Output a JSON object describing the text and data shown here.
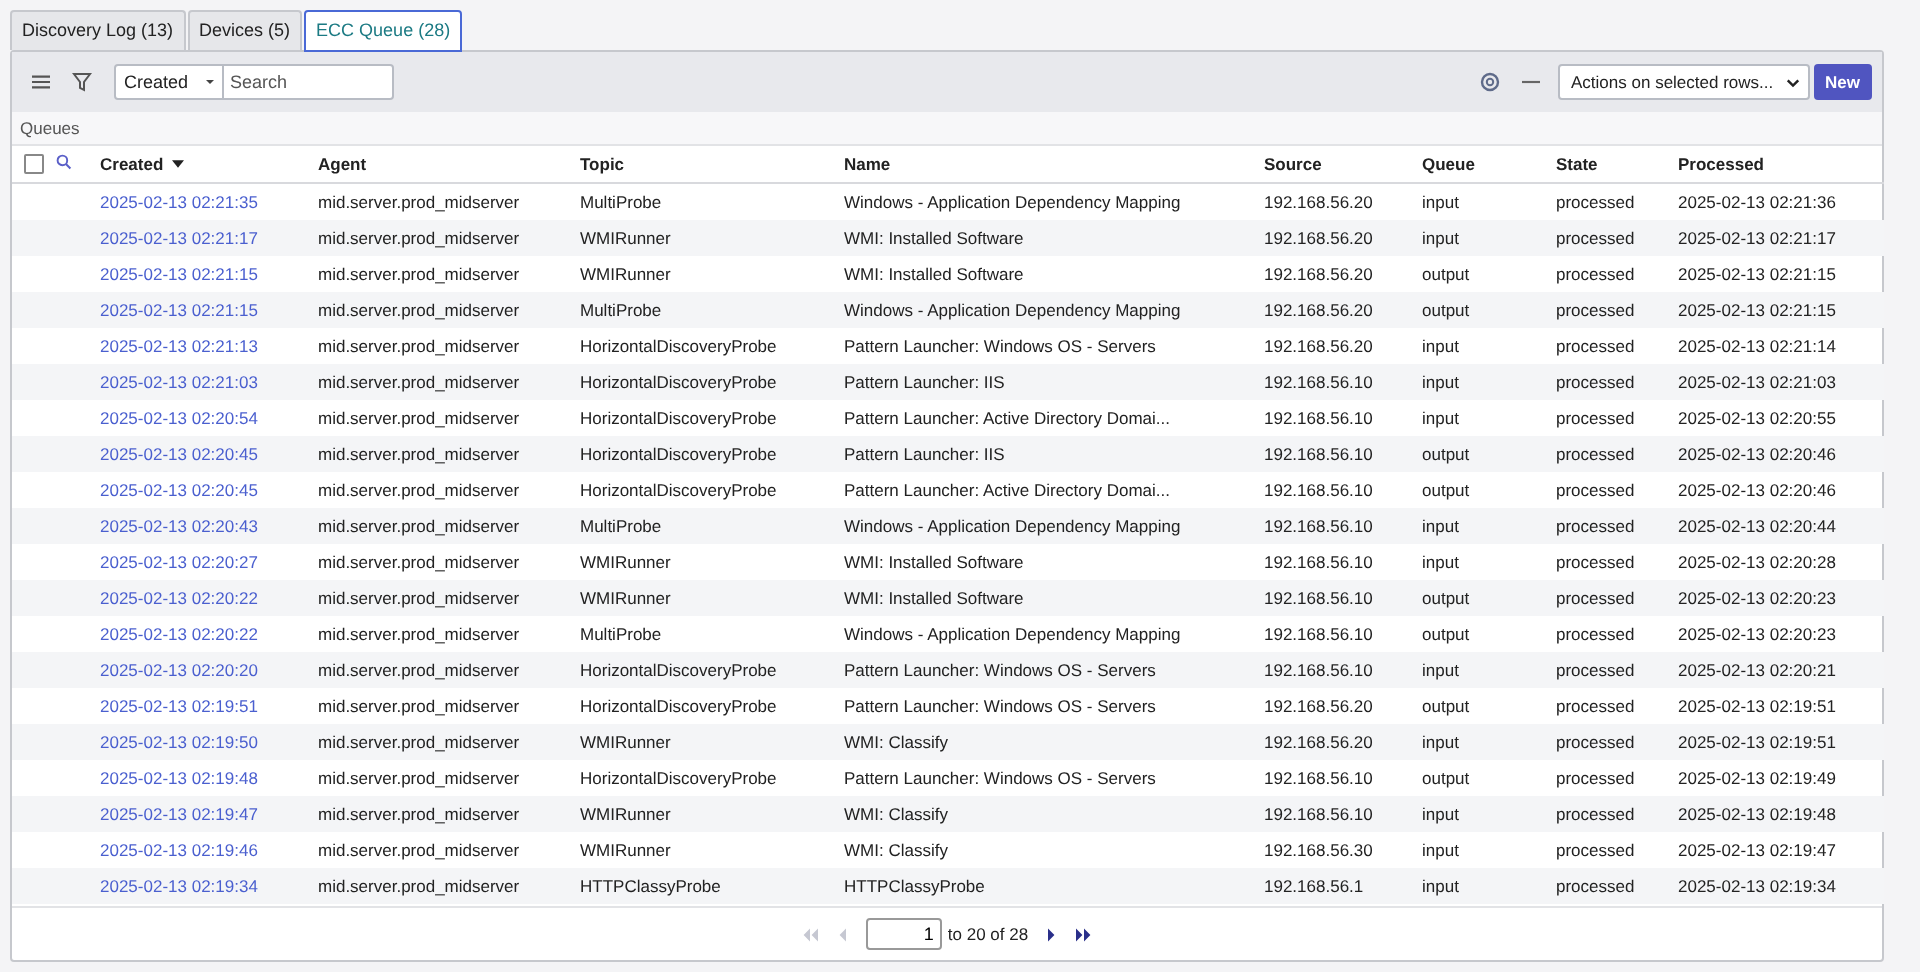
{
  "tabs": [
    {
      "label": "Discovery Log (13)",
      "selected": false
    },
    {
      "label": "Devices (5)",
      "selected": false
    },
    {
      "label": "ECC Queue (28)",
      "selected": true
    }
  ],
  "toolbar": {
    "filter_field": "Created",
    "search": {
      "placeholder": "Search"
    },
    "actions": "Actions on selected rows...",
    "new_button": "New"
  },
  "list_title": "Queues",
  "table": {
    "select_all": {
      "checked": false
    },
    "columns": [
      {
        "label": "Created",
        "sorted": true
      },
      {
        "label": "Agent",
        "sorted": false
      },
      {
        "label": "Topic",
        "sorted": false
      },
      {
        "label": "Name",
        "sorted": false
      },
      {
        "label": "Source",
        "sorted": false
      },
      {
        "label": "Queue",
        "sorted": false
      },
      {
        "label": "State",
        "sorted": false
      },
      {
        "label": "Processed",
        "sorted": false
      }
    ],
    "rows": [
      [
        "2025-02-13 02:21:35",
        "mid.server.prod_midserver",
        "MultiProbe",
        "Windows - Application Dependency Mapping",
        "192.168.56.20",
        "input",
        "processed",
        "2025-02-13 02:21:36"
      ],
      [
        "2025-02-13 02:21:17",
        "mid.server.prod_midserver",
        "WMIRunner",
        "WMI: Installed Software",
        "192.168.56.20",
        "input",
        "processed",
        "2025-02-13 02:21:17"
      ],
      [
        "2025-02-13 02:21:15",
        "mid.server.prod_midserver",
        "WMIRunner",
        "WMI: Installed Software",
        "192.168.56.20",
        "output",
        "processed",
        "2025-02-13 02:21:15"
      ],
      [
        "2025-02-13 02:21:15",
        "mid.server.prod_midserver",
        "MultiProbe",
        "Windows - Application Dependency Mapping",
        "192.168.56.20",
        "output",
        "processed",
        "2025-02-13 02:21:15"
      ],
      [
        "2025-02-13 02:21:13",
        "mid.server.prod_midserver",
        "HorizontalDiscoveryProbe",
        "Pattern Launcher: Windows OS - Servers",
        "192.168.56.20",
        "input",
        "processed",
        "2025-02-13 02:21:14"
      ],
      [
        "2025-02-13 02:21:03",
        "mid.server.prod_midserver",
        "HorizontalDiscoveryProbe",
        "Pattern Launcher: IIS",
        "192.168.56.10",
        "input",
        "processed",
        "2025-02-13 02:21:03"
      ],
      [
        "2025-02-13 02:20:54",
        "mid.server.prod_midserver",
        "HorizontalDiscoveryProbe",
        "Pattern Launcher: Active Directory Domai...",
        "192.168.56.10",
        "input",
        "processed",
        "2025-02-13 02:20:55"
      ],
      [
        "2025-02-13 02:20:45",
        "mid.server.prod_midserver",
        "HorizontalDiscoveryProbe",
        "Pattern Launcher: IIS",
        "192.168.56.10",
        "output",
        "processed",
        "2025-02-13 02:20:46"
      ],
      [
        "2025-02-13 02:20:45",
        "mid.server.prod_midserver",
        "HorizontalDiscoveryProbe",
        "Pattern Launcher: Active Directory Domai...",
        "192.168.56.10",
        "output",
        "processed",
        "2025-02-13 02:20:46"
      ],
      [
        "2025-02-13 02:20:43",
        "mid.server.prod_midserver",
        "MultiProbe",
        "Windows - Application Dependency Mapping",
        "192.168.56.10",
        "input",
        "processed",
        "2025-02-13 02:20:44"
      ],
      [
        "2025-02-13 02:20:27",
        "mid.server.prod_midserver",
        "WMIRunner",
        "WMI: Installed Software",
        "192.168.56.10",
        "input",
        "processed",
        "2025-02-13 02:20:28"
      ],
      [
        "2025-02-13 02:20:22",
        "mid.server.prod_midserver",
        "WMIRunner",
        "WMI: Installed Software",
        "192.168.56.10",
        "output",
        "processed",
        "2025-02-13 02:20:23"
      ],
      [
        "2025-02-13 02:20:22",
        "mid.server.prod_midserver",
        "MultiProbe",
        "Windows - Application Dependency Mapping",
        "192.168.56.10",
        "output",
        "processed",
        "2025-02-13 02:20:23"
      ],
      [
        "2025-02-13 02:20:20",
        "mid.server.prod_midserver",
        "HorizontalDiscoveryProbe",
        "Pattern Launcher: Windows OS - Servers",
        "192.168.56.10",
        "input",
        "processed",
        "2025-02-13 02:20:21"
      ],
      [
        "2025-02-13 02:19:51",
        "mid.server.prod_midserver",
        "HorizontalDiscoveryProbe",
        "Pattern Launcher: Windows OS - Servers",
        "192.168.56.20",
        "output",
        "processed",
        "2025-02-13 02:19:51"
      ],
      [
        "2025-02-13 02:19:50",
        "mid.server.prod_midserver",
        "WMIRunner",
        "WMI: Classify",
        "192.168.56.20",
        "input",
        "processed",
        "2025-02-13 02:19:51"
      ],
      [
        "2025-02-13 02:19:48",
        "mid.server.prod_midserver",
        "HorizontalDiscoveryProbe",
        "Pattern Launcher: Windows OS - Servers",
        "192.168.56.10",
        "output",
        "processed",
        "2025-02-13 02:19:49"
      ],
      [
        "2025-02-13 02:19:47",
        "mid.server.prod_midserver",
        "WMIRunner",
        "WMI: Classify",
        "192.168.56.10",
        "input",
        "processed",
        "2025-02-13 02:19:48"
      ],
      [
        "2025-02-13 02:19:46",
        "mid.server.prod_midserver",
        "WMIRunner",
        "WMI: Classify",
        "192.168.56.30",
        "input",
        "processed",
        "2025-02-13 02:19:47"
      ],
      [
        "2025-02-13 02:19:34",
        "mid.server.prod_midserver",
        "HTTPClassyProbe",
        "HTTPClassyProbe",
        "192.168.56.1",
        "input",
        "processed",
        "2025-02-13 02:19:34"
      ]
    ]
  },
  "pagination": {
    "first_disabled": true,
    "prev_disabled": true,
    "next_disabled": false,
    "last_disabled": false,
    "page": "1",
    "range": "to 20 of 28"
  }
}
